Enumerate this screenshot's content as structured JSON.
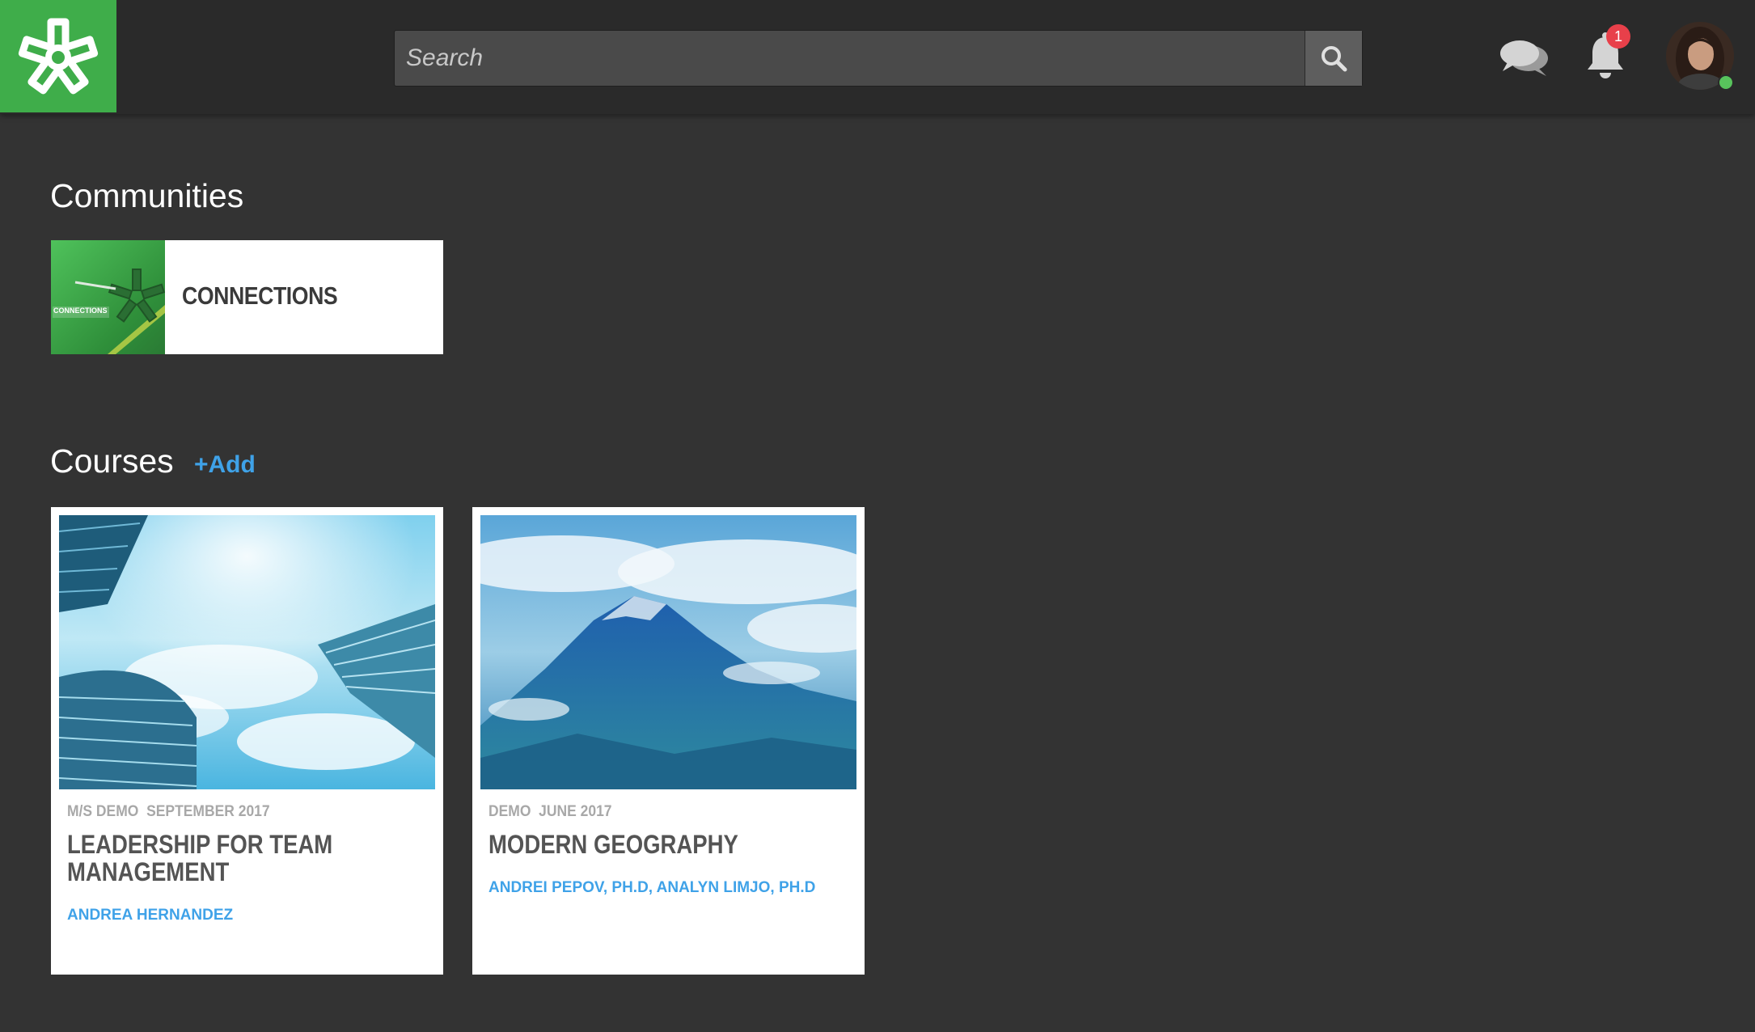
{
  "header": {
    "logo_icon": "asterisk-logo-icon",
    "search": {
      "placeholder": "Search",
      "value": ""
    },
    "search_button_icon": "search-icon",
    "messages_icon": "chat-bubbles-icon",
    "notifications": {
      "icon": "bell-icon",
      "badge_count": "1"
    },
    "avatar": {
      "status": "online"
    }
  },
  "communities": {
    "heading": "Communities",
    "items": [
      {
        "name": "CONNECTIONS",
        "thumb_text": "CONNECTIONS"
      }
    ]
  },
  "courses": {
    "heading": "Courses",
    "add_label": "+Add",
    "items": [
      {
        "org": "M/S DEMO",
        "date": "SEPTEMBER 2017",
        "title": "LEADERSHIP FOR TEAM MANAGEMENT",
        "instructors": "ANDREA HERNANDEZ",
        "image": "skyscrapers-sky-image"
      },
      {
        "org": "DEMO",
        "date": "JUNE 2017",
        "title": "MODERN GEOGRAPHY",
        "instructors": "ANDREI PEPOV, PH.D, ANALYN LIMJO, PH.D",
        "image": "mountain-clouds-image"
      }
    ]
  },
  "colors": {
    "brand_green": "#3fad4a",
    "link_blue": "#3fa2e8",
    "badge_red": "#e8404a",
    "background": "#333333",
    "topbar": "#2a2a2a"
  }
}
